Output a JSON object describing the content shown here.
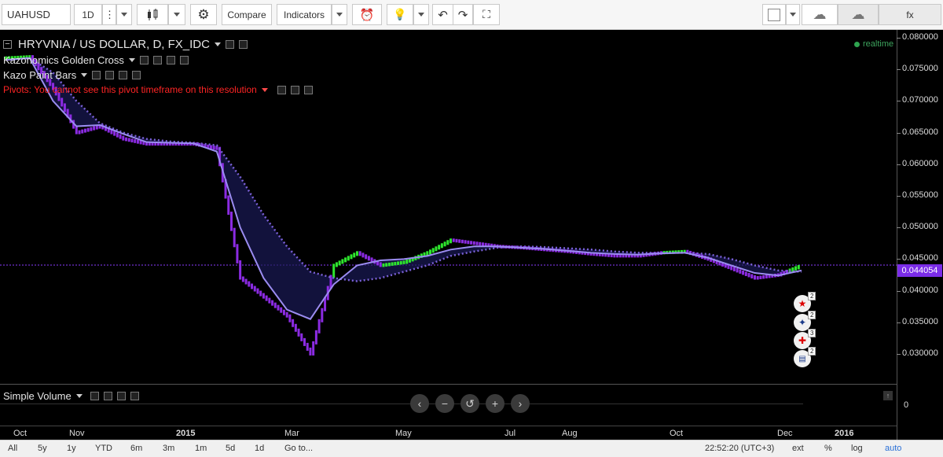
{
  "toolbar": {
    "symbol": "UAHUSD",
    "interval": "1D",
    "compare": "Compare",
    "indicators": "Indicators",
    "fx": "fx"
  },
  "chart": {
    "title": "HRYVNIA / US DOLLAR, D, FX_IDC",
    "indicators": [
      "Kazonomics Golden Cross",
      "Kazo Paint Bars"
    ],
    "pivot_warning": "Pivots: You cannot see this pivot timeframe on this resolution",
    "realtime": "realtime",
    "current_price": "0.044054",
    "volume_label": "Simple Volume",
    "volume_zero": "0",
    "price_ticks": [
      "0.080000",
      "0.075000",
      "0.070000",
      "0.065000",
      "0.060000",
      "0.055000",
      "0.050000",
      "0.045000",
      "0.040000",
      "0.035000",
      "0.030000"
    ],
    "time_ticks": [
      "Oct",
      "Nov",
      "2015",
      "Mar",
      "May",
      "Jul",
      "Aug",
      "Oct",
      "Dec",
      "2016"
    ],
    "flags": [
      {
        "icon": "china-flag-icon",
        "count": "2"
      },
      {
        "icon": "australia-flag-icon",
        "count": "2"
      },
      {
        "icon": "switzerland-flag-icon",
        "count": "3"
      },
      {
        "icon": "usa-flag-icon",
        "count": "2"
      }
    ],
    "colors": {
      "bear": "#8b2be2",
      "bull": "#2ee62e",
      "ma_slow": "#7b61d8",
      "ma_fast": "#9b8cf0",
      "signal": "#2e8b2e"
    }
  },
  "chart_data": {
    "type": "candlestick",
    "title": "HRYVNIA / US DOLLAR, D, FX_IDC",
    "ylim": [
      0.0285,
      0.0805
    ],
    "x_ticks": [
      "Oct",
      "Nov",
      "2015",
      "Mar",
      "May",
      "Jul",
      "Aug",
      "Oct",
      "Dec",
      "2016"
    ],
    "series": [
      {
        "name": "price",
        "points": [
          [
            "Oct",
            0.0768
          ],
          [
            "Nov",
            0.077
          ],
          [
            "Nov",
            0.072
          ],
          [
            "Nov",
            0.065
          ],
          [
            "Dec",
            0.066
          ],
          [
            "Dec",
            0.064
          ],
          [
            "2015",
            0.0632
          ],
          [
            "2015",
            0.0632
          ],
          [
            "Feb",
            0.0632
          ],
          [
            "Feb",
            0.0625
          ],
          [
            "Feb",
            0.042
          ],
          [
            "Feb",
            0.039
          ],
          [
            "Mar",
            0.036
          ],
          [
            "Mar",
            0.03
          ],
          [
            "Mar",
            0.044
          ],
          [
            "Mar",
            0.046
          ],
          [
            "Apr",
            0.044
          ],
          [
            "Apr",
            0.0445
          ],
          [
            "Apr",
            0.046
          ],
          [
            "May",
            0.048
          ],
          [
            "May",
            0.0475
          ],
          [
            "Jun",
            0.047
          ],
          [
            "Jun",
            0.0468
          ],
          [
            "Jul",
            0.0465
          ],
          [
            "Jul",
            0.0462
          ],
          [
            "Aug",
            0.0458
          ],
          [
            "Aug",
            0.0455
          ],
          [
            "Sep",
            0.0455
          ],
          [
            "Sep",
            0.046
          ],
          [
            "Oct",
            0.0462
          ],
          [
            "Oct",
            0.045
          ],
          [
            "Nov",
            0.0435
          ],
          [
            "Nov",
            0.042
          ],
          [
            "Dec",
            0.0425
          ],
          [
            "Dec",
            0.044
          ]
        ]
      },
      {
        "name": "ma_fast",
        "points": [
          [
            "Oct",
            0.0765
          ],
          [
            "Nov",
            0.0768
          ],
          [
            "Nov",
            0.07
          ],
          [
            "Nov",
            0.066
          ],
          [
            "Dec",
            0.0662
          ],
          [
            "Dec",
            0.0648
          ],
          [
            "2015",
            0.0635
          ],
          [
            "2015",
            0.0634
          ],
          [
            "Feb",
            0.0633
          ],
          [
            "Feb",
            0.062
          ],
          [
            "Feb",
            0.05
          ],
          [
            "Feb",
            0.042
          ],
          [
            "Mar",
            0.037
          ],
          [
            "Mar",
            0.0355
          ],
          [
            "Mar",
            0.041
          ],
          [
            "Mar",
            0.044
          ],
          [
            "Apr",
            0.0448
          ],
          [
            "Apr",
            0.045
          ],
          [
            "Apr",
            0.0455
          ],
          [
            "May",
            0.0465
          ],
          [
            "May",
            0.047
          ],
          [
            "Jun",
            0.047
          ],
          [
            "Jun",
            0.0468
          ],
          [
            "Jul",
            0.0466
          ],
          [
            "Jul",
            0.0463
          ],
          [
            "Aug",
            0.046
          ],
          [
            "Aug",
            0.0458
          ],
          [
            "Sep",
            0.0457
          ],
          [
            "Sep",
            0.0459
          ],
          [
            "Oct",
            0.046
          ],
          [
            "Oct",
            0.0452
          ],
          [
            "Nov",
            0.044
          ],
          [
            "Nov",
            0.0428
          ],
          [
            "Dec",
            0.0424
          ],
          [
            "Dec",
            0.0432
          ]
        ]
      },
      {
        "name": "ma_slow",
        "points": [
          [
            "Oct",
            0.0765
          ],
          [
            "Nov",
            0.0768
          ],
          [
            "Nov",
            0.0745
          ],
          [
            "Nov",
            0.07
          ],
          [
            "Dec",
            0.0665
          ],
          [
            "Dec",
            0.065
          ],
          [
            "2015",
            0.064
          ],
          [
            "2015",
            0.0636
          ],
          [
            "Feb",
            0.0634
          ],
          [
            "Feb",
            0.063
          ],
          [
            "Feb",
            0.058
          ],
          [
            "Feb",
            0.052
          ],
          [
            "Mar",
            0.047
          ],
          [
            "Mar",
            0.043
          ],
          [
            "Mar",
            0.042
          ],
          [
            "Mar",
            0.0415
          ],
          [
            "Apr",
            0.042
          ],
          [
            "Apr",
            0.043
          ],
          [
            "Apr",
            0.044
          ],
          [
            "May",
            0.0455
          ],
          [
            "May",
            0.0462
          ],
          [
            "Jun",
            0.0468
          ],
          [
            "Jun",
            0.047
          ],
          [
            "Jul",
            0.0469
          ],
          [
            "Jul",
            0.0467
          ],
          [
            "Aug",
            0.0465
          ],
          [
            "Aug",
            0.0462
          ],
          [
            "Sep",
            0.046
          ],
          [
            "Sep",
            0.046
          ],
          [
            "Oct",
            0.046
          ],
          [
            "Oct",
            0.0458
          ],
          [
            "Nov",
            0.045
          ],
          [
            "Nov",
            0.044
          ],
          [
            "Dec",
            0.0432
          ],
          [
            "Dec",
            0.043
          ]
        ]
      }
    ]
  },
  "bottom": {
    "ranges": [
      "All",
      "5y",
      "1y",
      "YTD",
      "6m",
      "3m",
      "1m",
      "5d",
      "1d",
      "Go to..."
    ],
    "clock": "22:52:20 (UTC+3)",
    "options": [
      "ext",
      "%",
      "log",
      "auto"
    ]
  }
}
